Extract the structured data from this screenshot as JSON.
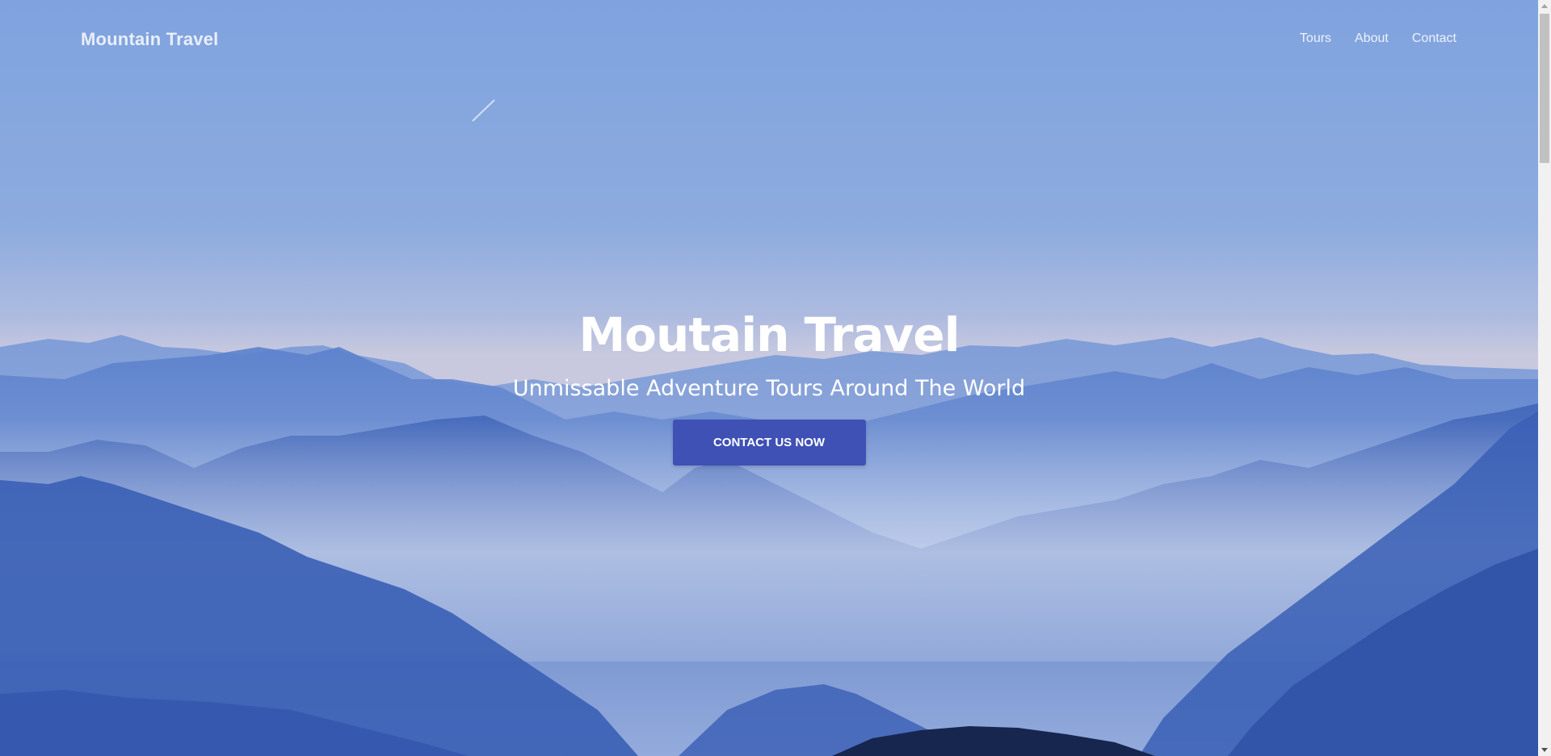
{
  "header": {
    "brand": "Mountain Travel",
    "nav": [
      {
        "label": "Tours"
      },
      {
        "label": "About"
      },
      {
        "label": "Contact"
      }
    ]
  },
  "hero": {
    "title": "Moutain Travel",
    "subtitle": "Unmissable Adventure Tours Around The World",
    "cta_label": "CONTACT US NOW",
    "background": "misty blue mountain ranges"
  },
  "colors": {
    "cta": "#3f51b5",
    "sky": "#7ea3df",
    "mountains": "#4a72c0"
  }
}
